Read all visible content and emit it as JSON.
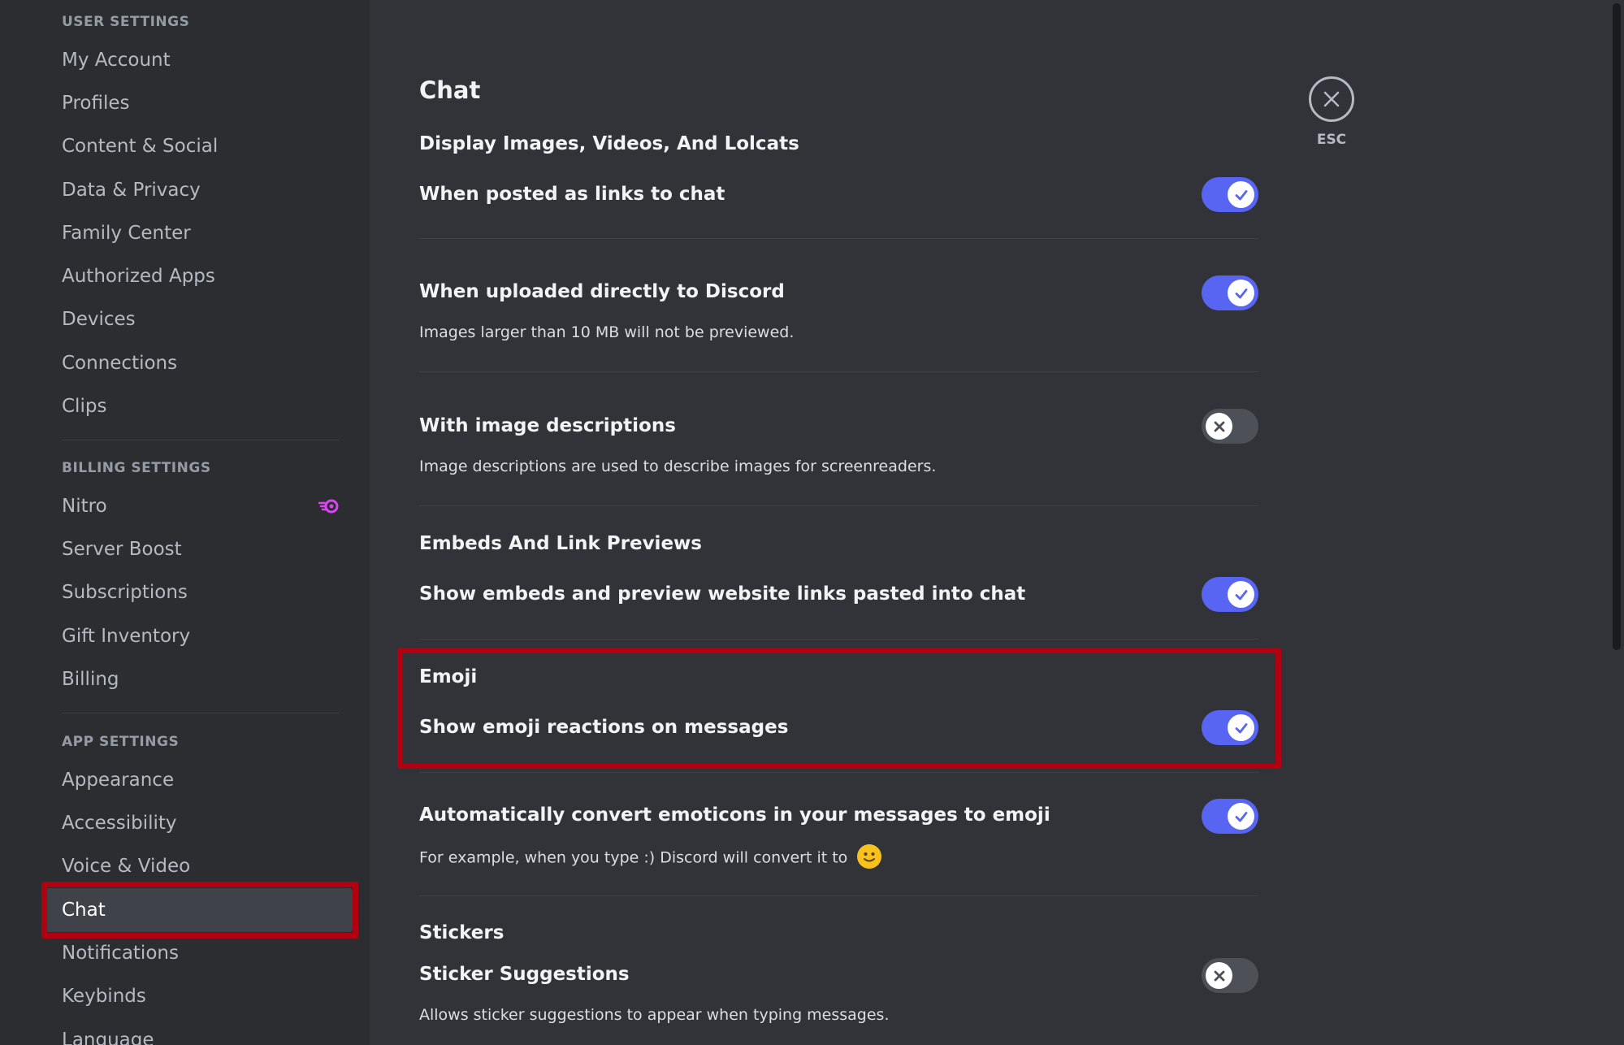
{
  "sidebar": {
    "user_settings_header": "User Settings",
    "user_items": [
      "My Account",
      "Profiles",
      "Content & Social",
      "Data & Privacy",
      "Family Center",
      "Authorized Apps",
      "Devices",
      "Connections",
      "Clips"
    ],
    "billing_settings_header": "Billing Settings",
    "billing_items": [
      "Nitro",
      "Server Boost",
      "Subscriptions",
      "Gift Inventory",
      "Billing"
    ],
    "app_settings_header": "App Settings",
    "app_items": [
      "Appearance",
      "Accessibility",
      "Voice & Video",
      "Chat",
      "Notifications",
      "Keybinds",
      "Language"
    ],
    "active_item": "Chat"
  },
  "close": {
    "label": "ESC",
    "icon": "close-icon"
  },
  "page": {
    "title": "Chat",
    "section_media": "Display Images, Videos, And Lolcats",
    "links_label": "When posted as links to chat",
    "uploaded_label": "When uploaded directly to Discord",
    "uploaded_desc": "Images larger than 10 MB will not be previewed.",
    "descriptions_label": "With image descriptions",
    "descriptions_desc": "Image descriptions are used to describe images for screenreaders.",
    "section_embeds": "Embeds And Link Previews",
    "embeds_label": "Show embeds and preview website links pasted into chat",
    "section_emoji": "Emoji",
    "reactions_label": "Show emoji reactions on messages",
    "emoticons_label": "Automatically convert emoticons in your messages to emoji",
    "emoticons_desc": "For example, when you type :) Discord will convert it to",
    "section_stickers": "Stickers",
    "stickers_label": "Sticker Suggestions",
    "stickers_desc": "Allows sticker suggestions to appear when typing messages."
  },
  "toggles": {
    "links": true,
    "uploaded": true,
    "descriptions": false,
    "embeds": true,
    "reactions": true,
    "emoticons": true,
    "stickers": false
  },
  "colors": {
    "accent": "#5865f2",
    "highlight": "#b30010",
    "nitro": "#d946ef"
  }
}
